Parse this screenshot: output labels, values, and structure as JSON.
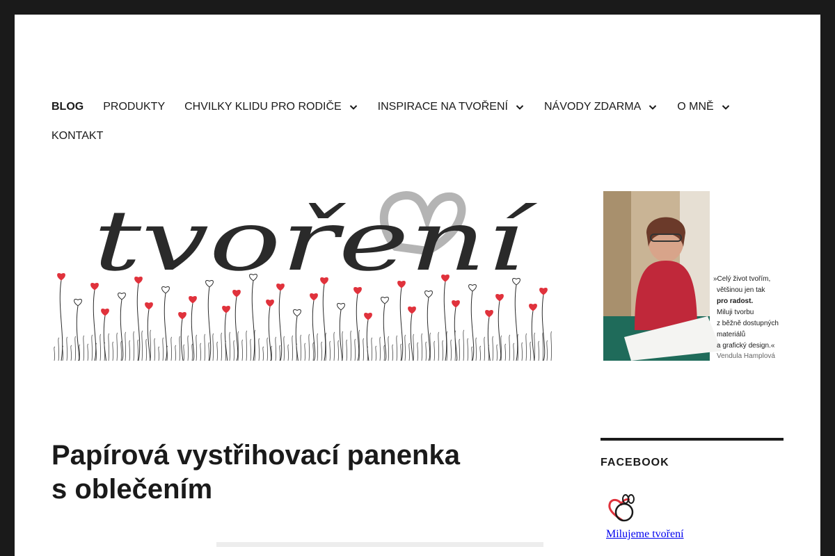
{
  "nav": {
    "items": [
      {
        "label": "BLOG",
        "active": true,
        "dropdown": false
      },
      {
        "label": "PRODUKTY",
        "active": false,
        "dropdown": false
      },
      {
        "label": "CHVILKY KLIDU PRO RODIČE",
        "active": false,
        "dropdown": true
      },
      {
        "label": "INSPIRACE NA TVOŘENÍ",
        "active": false,
        "dropdown": true
      },
      {
        "label": "NÁVODY ZDARMA",
        "active": false,
        "dropdown": true
      },
      {
        "label": "O MNĚ",
        "active": false,
        "dropdown": true
      },
      {
        "label": "KONTAKT",
        "active": false,
        "dropdown": false
      }
    ]
  },
  "header": {
    "logo_text": "tvoření"
  },
  "side_image": {
    "quote_lines": [
      "»Celý život tvořím,",
      "většinou jen tak",
      "pro radost.",
      "Miluji tvorbu",
      "z běžně dostupných",
      "materiálů",
      "a grafický design.«",
      "Vendula Hamplová"
    ]
  },
  "post": {
    "title_line1": "Papírová vystřihovací panenka",
    "title_line2": "s oblečením"
  },
  "sidebar": {
    "widget_title": "FACEBOOK",
    "page_link": "Milujeme tvoření"
  },
  "colors": {
    "frame": "#1a1a1a",
    "accent_red": "#e0323c",
    "heart_grey": "#b4b4b4",
    "link": "#0000ee"
  }
}
